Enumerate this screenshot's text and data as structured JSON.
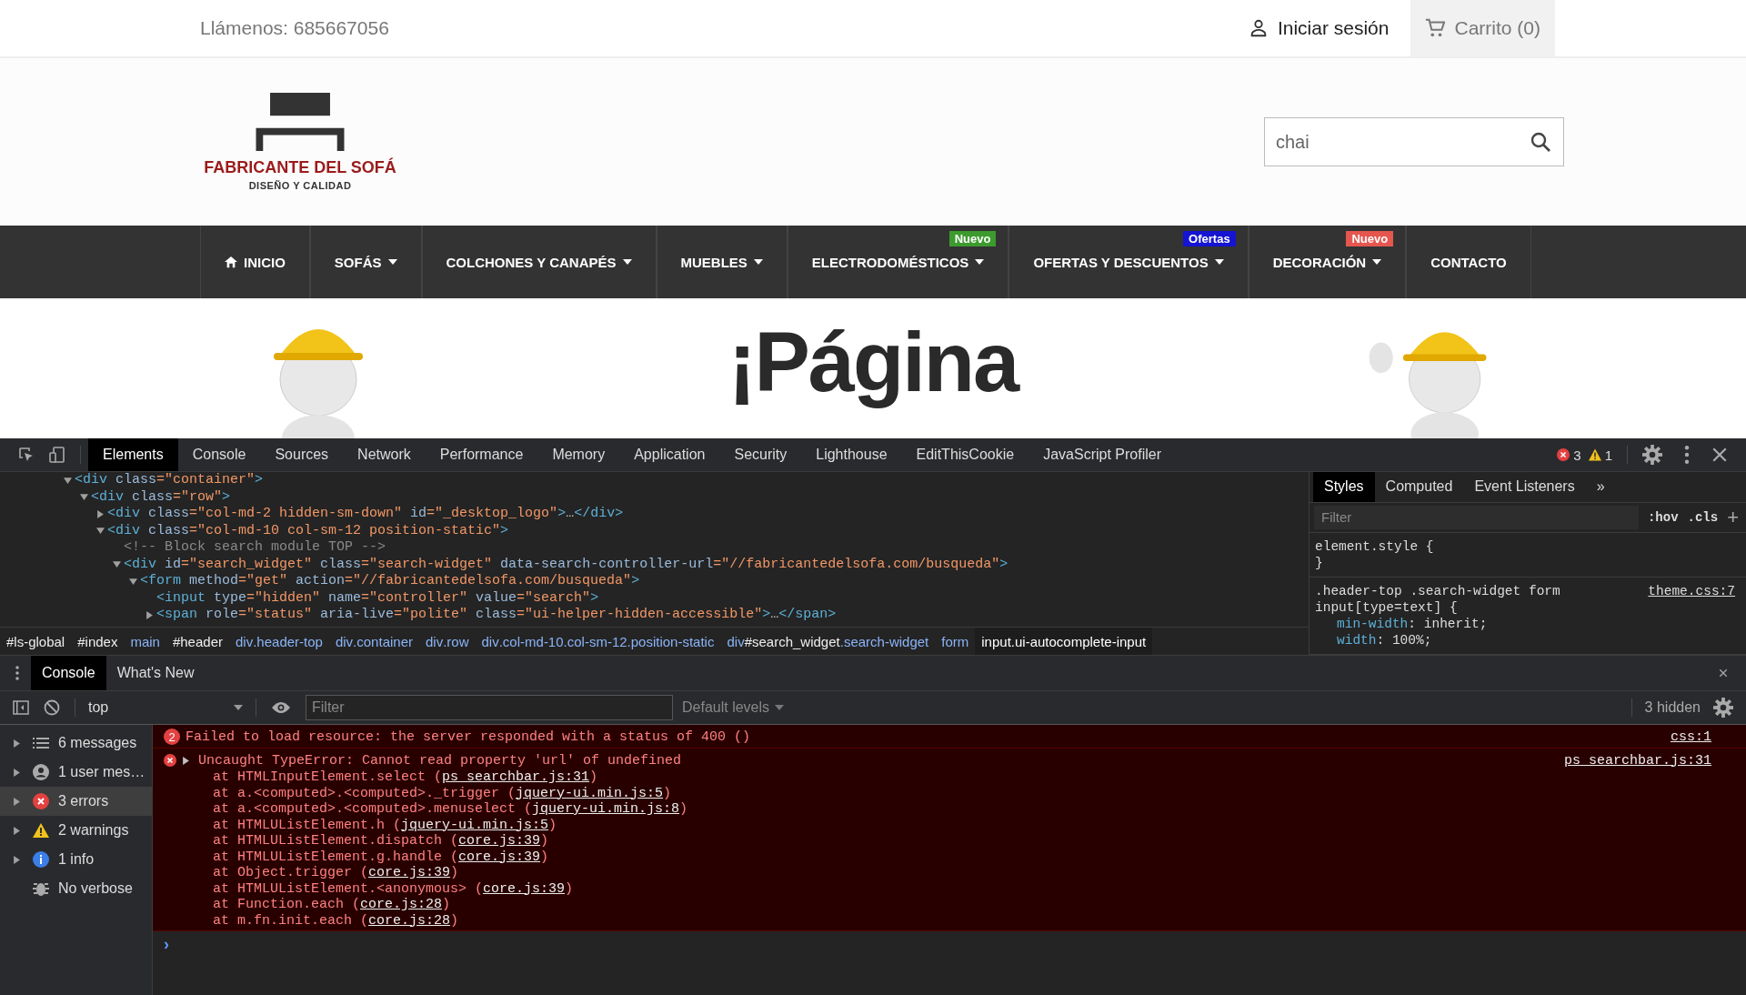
{
  "top_bar": {
    "phone": "Llámenos: 685667056",
    "login": "Iniciar sesión",
    "cart": "Carrito (0)"
  },
  "header": {
    "logo_title": "FABRICANTE DEL SOFÁ",
    "logo_subtitle": "DISEÑO Y CALIDAD",
    "search": {
      "value": "chai"
    }
  },
  "nav": [
    {
      "label": "INICIO",
      "kind": "home",
      "dropdown": false
    },
    {
      "label": "SOFÁS",
      "dropdown": true
    },
    {
      "label": "COLCHONES Y CANAPÉS",
      "dropdown": true
    },
    {
      "label": "MUEBLES",
      "dropdown": true
    },
    {
      "label": "ELECTRODOMÉSTICOS",
      "dropdown": true,
      "badge": {
        "text": "Nuevo",
        "color": "#3c9a2e"
      }
    },
    {
      "label": "OFERTAS Y DESCUENTOS",
      "dropdown": true,
      "badge": {
        "text": "Ofertas",
        "color": "#1414d2"
      }
    },
    {
      "label": "DECORACIÓN",
      "dropdown": true,
      "badge": {
        "text": "Nuevo",
        "color": "#e5564f"
      }
    },
    {
      "label": "CONTACTO",
      "dropdown": false
    }
  ],
  "banner": {
    "title": "¡Página"
  },
  "devtools": {
    "tabs": [
      {
        "label": "Elements",
        "selected": true
      },
      {
        "label": "Console",
        "selected": false
      },
      {
        "label": "Sources",
        "selected": false
      },
      {
        "label": "Network",
        "selected": false
      },
      {
        "label": "Performance",
        "selected": false
      },
      {
        "label": "Memory",
        "selected": false
      },
      {
        "label": "Application",
        "selected": false
      },
      {
        "label": "Security",
        "selected": false
      },
      {
        "label": "Lighthouse",
        "selected": false
      },
      {
        "label": "EditThisCookie",
        "selected": false
      },
      {
        "label": "JavaScript Profiler",
        "selected": false
      }
    ],
    "error_count": "3",
    "warning_count": "1",
    "dom_tree": [
      {
        "text": "<div class=\"container\">",
        "expanded": true,
        "children": [
          {
            "text": "<div class=\"row\">",
            "expanded": true,
            "children": [
              {
                "text": "<div class=\"col-md-2 hidden-sm-down\" id=\"_desktop_logo\">…</div>",
                "expanded": false
              },
              {
                "text": "<div class=\"col-md-10 col-sm-12 position-static\">",
                "expanded": true,
                "children": [
                  {
                    "text": "<!-- Block search module TOP -->"
                  },
                  {
                    "text": "<div id=\"search_widget\" class=\"search-widget\" data-search-controller-url=\"//fabricantedelsofa.com/busqueda\">",
                    "expanded": true,
                    "children": [
                      {
                        "text": "<form method=\"get\" action=\"//fabricantedelsofa.com/busqueda\">",
                        "expanded": true,
                        "children": [
                          {
                            "text": "<input type=\"hidden\" name=\"controller\" value=\"search\">"
                          },
                          {
                            "text": "<span role=\"status\" aria-live=\"polite\" class=\"ui-helper-hidden-accessible\">…</span>",
                            "expanded": false
                          }
                        ]
                      }
                    ]
                  }
                ]
              }
            ]
          }
        ]
      }
    ],
    "breadcrumbs": [
      {
        "label": "#ls-global",
        "selected": false
      },
      {
        "label": "#index",
        "selected": false
      },
      {
        "label": "main",
        "selected": false
      },
      {
        "label": "#header",
        "selected": false
      },
      {
        "label": "div.header-top",
        "selected": false
      },
      {
        "label": "div.container",
        "selected": false
      },
      {
        "label": "div.row",
        "selected": false
      },
      {
        "label": "div.col-md-10.col-sm-12.position-static",
        "selected": false
      },
      {
        "label": "div#search_widget.search-widget",
        "selected": false
      },
      {
        "label": "form",
        "selected": false
      },
      {
        "label": "input.ui-autocomplete-input",
        "selected": true
      }
    ],
    "styles_tabs": [
      {
        "label": "Styles",
        "selected": true
      },
      {
        "label": "Computed",
        "selected": false
      },
      {
        "label": "Event Listeners",
        "selected": false
      }
    ],
    "styles_more": "»",
    "styles_filter": {
      "placeholder": "Filter"
    },
    "styles_toggles": [
      ":hov",
      ".cls"
    ],
    "styles_add": "+",
    "rules": [
      {
        "selector": "element.style {",
        "close": "}"
      },
      {
        "selector": ".header-top .search-widget form input[type=text] {",
        "source": "theme.css:7",
        "properties": [
          {
            "name": "min-width",
            "value": ": inherit;"
          },
          {
            "name": "width",
            "value": ": 100%;"
          }
        ]
      }
    ]
  },
  "console": {
    "drawer_tabs": [
      {
        "label": "Console",
        "selected": true
      },
      {
        "label": "What's New",
        "selected": false
      }
    ],
    "context": "top",
    "filter": {
      "placeholder": "Filter"
    },
    "levels": "Default levels",
    "hidden": "3 hidden",
    "sidebar": [
      {
        "kind": "messages",
        "label": "6 messages",
        "expanded": false,
        "selected": false
      },
      {
        "kind": "user",
        "label": "1 user mes…",
        "expanded": false,
        "selected": false
      },
      {
        "kind": "errors",
        "label": "3 errors",
        "expanded": false,
        "selected": true
      },
      {
        "kind": "warnings",
        "label": "2 warnings",
        "expanded": false,
        "selected": false
      },
      {
        "kind": "info",
        "label": "1 info",
        "expanded": false,
        "selected": false
      },
      {
        "kind": "verbose",
        "label": "No verbose",
        "selected": false
      }
    ],
    "messages": [
      {
        "kind": "grouped",
        "count": "2",
        "text": "Failed to load resource: the server responded with a status of 400 ()",
        "source": "css:1"
      },
      {
        "kind": "error",
        "expanded": false,
        "text": "Uncaught TypeError: Cannot read property 'url' of undefined",
        "source": "ps_searchbar.js:31",
        "stack": [
          {
            "before": "at HTMLInputElement.select (",
            "link": "ps_searchbar.js:31",
            "after": ")"
          },
          {
            "before": "at a.<computed>.<computed>._trigger (",
            "link": "jquery-ui.min.js:5",
            "after": ")"
          },
          {
            "before": "at a.<computed>.<computed>.menuselect (",
            "link": "jquery-ui.min.js:8",
            "after": ")"
          },
          {
            "before": "at HTMLUListElement.h (",
            "link": "jquery-ui.min.js:5",
            "after": ")"
          },
          {
            "before": "at HTMLUListElement.dispatch (",
            "link": "core.js:39",
            "after": ")"
          },
          {
            "before": "at HTMLUListElement.g.handle (",
            "link": "core.js:39",
            "after": ")"
          },
          {
            "before": "at Object.trigger (",
            "link": "core.js:39",
            "after": ")"
          },
          {
            "before": "at HTMLUListElement.<anonymous> (",
            "link": "core.js:39",
            "after": ")"
          },
          {
            "before": "at Function.each (",
            "link": "core.js:28",
            "after": ")"
          },
          {
            "before": "at m.fn.init.each (",
            "link": "core.js:28",
            "after": ")"
          }
        ]
      }
    ],
    "prompt": "›"
  }
}
